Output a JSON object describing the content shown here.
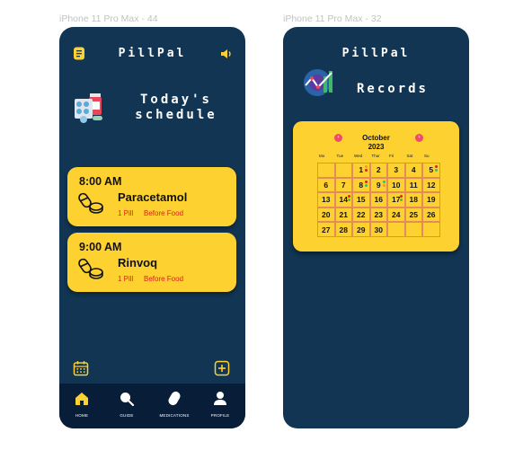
{
  "frames": {
    "left_label": "iPhone 11 Pro Max - 44",
    "right_label": "iPhone 11 Pro Max - 32"
  },
  "home": {
    "app_title": "PillPal",
    "heading_line1": "Today's",
    "heading_line2": "schedule",
    "cards": [
      {
        "time": "8:00 AM",
        "medication": "Paracetamol",
        "dose": "1 Pill",
        "instruction": "Before Food"
      },
      {
        "time": "9:00 AM",
        "medication": "Rinvoq",
        "dose": "1 Pill",
        "instruction": "Before Food"
      }
    ],
    "nav": [
      {
        "label": "HOME",
        "icon": "home-icon"
      },
      {
        "label": "GUIDE",
        "icon": "search-icon"
      },
      {
        "label": "MEDICATIONS",
        "icon": "pill-icon"
      },
      {
        "label": "PROFILE",
        "icon": "user-icon"
      }
    ]
  },
  "records": {
    "app_title": "PillPal",
    "heading": "Records",
    "calendar": {
      "month": "October",
      "year": "2023",
      "weekdays": [
        "Mo",
        "Tue",
        "Wed",
        "Thur",
        "Fri",
        "Sat",
        "Su"
      ],
      "days": [
        "",
        "",
        "1",
        "2",
        "3",
        "4",
        "5",
        "6",
        "7",
        "8",
        "9",
        "10",
        "11",
        "12",
        "13",
        "14",
        "15",
        "16",
        "17",
        "18",
        "19",
        "20",
        "21",
        "22",
        "23",
        "24",
        "25",
        "26",
        "27",
        "28",
        "29",
        "30",
        "",
        "",
        ""
      ],
      "marked_days": [
        "1",
        "5",
        "8",
        "9",
        "14",
        "17"
      ]
    }
  },
  "colors": {
    "background": "#113552",
    "card": "#fdd130",
    "nav": "#081d37",
    "accent_red": "#e02020"
  }
}
